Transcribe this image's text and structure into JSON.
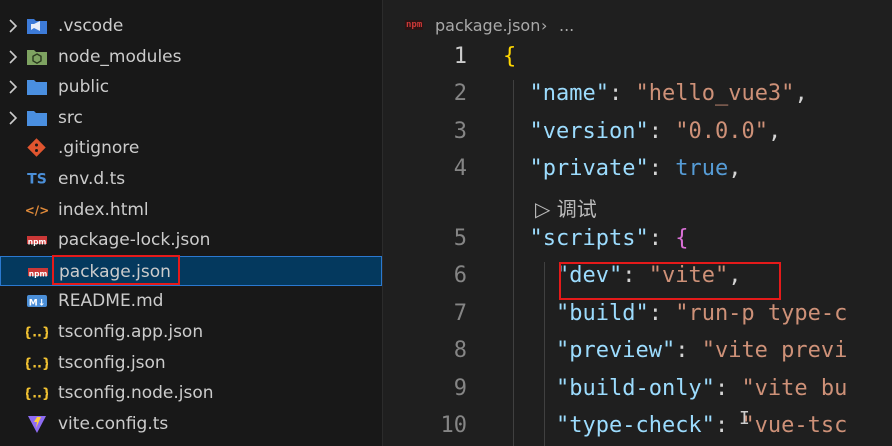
{
  "explorer": {
    "items": [
      {
        "label": ".vscode",
        "kind": "folder",
        "icon": "vscode-folder-icon",
        "expandable": true
      },
      {
        "label": "node_modules",
        "kind": "folder",
        "icon": "node-modules-folder-icon",
        "expandable": true
      },
      {
        "label": "public",
        "kind": "folder",
        "icon": "folder-icon",
        "expandable": true
      },
      {
        "label": "src",
        "kind": "folder",
        "icon": "folder-icon",
        "expandable": true
      },
      {
        "label": ".gitignore",
        "kind": "file",
        "icon": "git-icon"
      },
      {
        "label": "env.d.ts",
        "kind": "file",
        "icon": "typescript-icon",
        "icon_text": "TS"
      },
      {
        "label": "index.html",
        "kind": "file",
        "icon": "html-icon",
        "icon_text": "</>"
      },
      {
        "label": "package-lock.json",
        "kind": "file",
        "icon": "npm-icon",
        "icon_text": "npm"
      },
      {
        "label": "package.json",
        "kind": "file",
        "icon": "npm-icon",
        "icon_text": "npm",
        "selected": true
      },
      {
        "label": "README.md",
        "kind": "file",
        "icon": "markdown-icon",
        "icon_text": "M↓"
      },
      {
        "label": "tsconfig.app.json",
        "kind": "file",
        "icon": "json-icon",
        "icon_text": "{..}"
      },
      {
        "label": "tsconfig.json",
        "kind": "file",
        "icon": "json-icon",
        "icon_text": "{..}"
      },
      {
        "label": "tsconfig.node.json",
        "kind": "file",
        "icon": "json-icon",
        "icon_text": "{..}"
      },
      {
        "label": "vite.config.ts",
        "kind": "file",
        "icon": "vite-icon"
      }
    ]
  },
  "breadcrumb": {
    "file": "package.json",
    "sep": "›",
    "more": "...",
    "icon_text": "npm"
  },
  "editor": {
    "line_numbers": [
      "1",
      "2",
      "3",
      "4",
      "5",
      "6",
      "7",
      "8",
      "9",
      "10"
    ],
    "active_line": "1",
    "codelens": "▷ 调试",
    "lines": [
      [
        {
          "t": "{",
          "c": "br"
        }
      ],
      [
        {
          "t": "  ",
          "c": "p"
        },
        {
          "t": "\"name\"",
          "c": "k"
        },
        {
          "t": ": ",
          "c": "p"
        },
        {
          "t": "\"hello_vue3\"",
          "c": "s"
        },
        {
          "t": ",",
          "c": "p"
        }
      ],
      [
        {
          "t": "  ",
          "c": "p"
        },
        {
          "t": "\"version\"",
          "c": "k"
        },
        {
          "t": ": ",
          "c": "p"
        },
        {
          "t": "\"0.0.0\"",
          "c": "s"
        },
        {
          "t": ",",
          "c": "p"
        }
      ],
      [
        {
          "t": "  ",
          "c": "p"
        },
        {
          "t": "\"private\"",
          "c": "k"
        },
        {
          "t": ": ",
          "c": "p"
        },
        {
          "t": "true",
          "c": "b"
        },
        {
          "t": ",",
          "c": "p"
        }
      ],
      [
        {
          "t": "  ",
          "c": "p"
        },
        {
          "t": "\"scripts\"",
          "c": "k"
        },
        {
          "t": ": ",
          "c": "p"
        },
        {
          "t": "{",
          "c": "br2"
        }
      ],
      [
        {
          "t": "    ",
          "c": "p"
        },
        {
          "t": "\"dev\"",
          "c": "k"
        },
        {
          "t": ": ",
          "c": "p"
        },
        {
          "t": "\"vite\"",
          "c": "s"
        },
        {
          "t": ",",
          "c": "p"
        }
      ],
      [
        {
          "t": "    ",
          "c": "p"
        },
        {
          "t": "\"build\"",
          "c": "k"
        },
        {
          "t": ": ",
          "c": "p"
        },
        {
          "t": "\"run-p type-c",
          "c": "s"
        }
      ],
      [
        {
          "t": "    ",
          "c": "p"
        },
        {
          "t": "\"preview\"",
          "c": "k"
        },
        {
          "t": ": ",
          "c": "p"
        },
        {
          "t": "\"vite previ",
          "c": "s"
        }
      ],
      [
        {
          "t": "    ",
          "c": "p"
        },
        {
          "t": "\"build-only\"",
          "c": "k"
        },
        {
          "t": ": ",
          "c": "p"
        },
        {
          "t": "\"vite bu",
          "c": "s"
        }
      ],
      [
        {
          "t": "    ",
          "c": "p"
        },
        {
          "t": "\"type-check\"",
          "c": "k"
        },
        {
          "t": ": ",
          "c": "p"
        },
        {
          "t": "\"vue-tsc",
          "c": "s"
        }
      ]
    ]
  },
  "colors": {
    "key": "#9cdcfe",
    "string": "#ce9178",
    "boolean": "#569cd6",
    "bracket": "#ffd700",
    "bracket_nested": "#da70d6",
    "selection": "#04395e",
    "highlight_box": "#e51a1a"
  }
}
